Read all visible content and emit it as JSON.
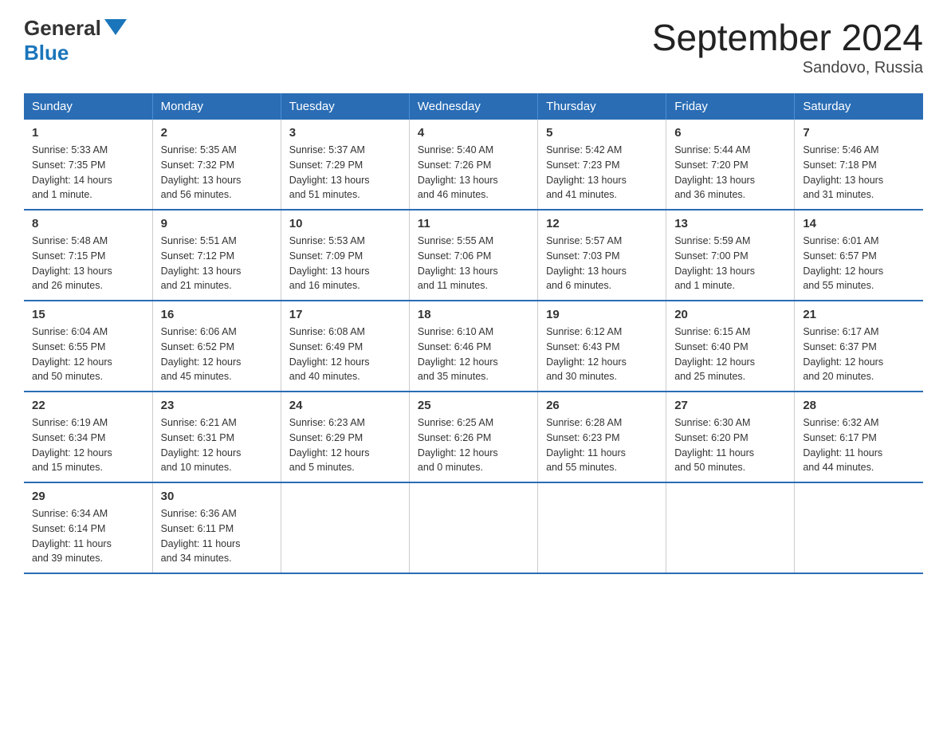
{
  "header": {
    "logo_general": "General",
    "logo_blue": "Blue",
    "title": "September 2024",
    "subtitle": "Sandovo, Russia"
  },
  "weekdays": [
    "Sunday",
    "Monday",
    "Tuesday",
    "Wednesday",
    "Thursday",
    "Friday",
    "Saturday"
  ],
  "weeks": [
    [
      {
        "day": "1",
        "sunrise": "5:33 AM",
        "sunset": "7:35 PM",
        "daylight": "14 hours and 1 minute."
      },
      {
        "day": "2",
        "sunrise": "5:35 AM",
        "sunset": "7:32 PM",
        "daylight": "13 hours and 56 minutes."
      },
      {
        "day": "3",
        "sunrise": "5:37 AM",
        "sunset": "7:29 PM",
        "daylight": "13 hours and 51 minutes."
      },
      {
        "day": "4",
        "sunrise": "5:40 AM",
        "sunset": "7:26 PM",
        "daylight": "13 hours and 46 minutes."
      },
      {
        "day": "5",
        "sunrise": "5:42 AM",
        "sunset": "7:23 PM",
        "daylight": "13 hours and 41 minutes."
      },
      {
        "day": "6",
        "sunrise": "5:44 AM",
        "sunset": "7:20 PM",
        "daylight": "13 hours and 36 minutes."
      },
      {
        "day": "7",
        "sunrise": "5:46 AM",
        "sunset": "7:18 PM",
        "daylight": "13 hours and 31 minutes."
      }
    ],
    [
      {
        "day": "8",
        "sunrise": "5:48 AM",
        "sunset": "7:15 PM",
        "daylight": "13 hours and 26 minutes."
      },
      {
        "day": "9",
        "sunrise": "5:51 AM",
        "sunset": "7:12 PM",
        "daylight": "13 hours and 21 minutes."
      },
      {
        "day": "10",
        "sunrise": "5:53 AM",
        "sunset": "7:09 PM",
        "daylight": "13 hours and 16 minutes."
      },
      {
        "day": "11",
        "sunrise": "5:55 AM",
        "sunset": "7:06 PM",
        "daylight": "13 hours and 11 minutes."
      },
      {
        "day": "12",
        "sunrise": "5:57 AM",
        "sunset": "7:03 PM",
        "daylight": "13 hours and 6 minutes."
      },
      {
        "day": "13",
        "sunrise": "5:59 AM",
        "sunset": "7:00 PM",
        "daylight": "13 hours and 1 minute."
      },
      {
        "day": "14",
        "sunrise": "6:01 AM",
        "sunset": "6:57 PM",
        "daylight": "12 hours and 55 minutes."
      }
    ],
    [
      {
        "day": "15",
        "sunrise": "6:04 AM",
        "sunset": "6:55 PM",
        "daylight": "12 hours and 50 minutes."
      },
      {
        "day": "16",
        "sunrise": "6:06 AM",
        "sunset": "6:52 PM",
        "daylight": "12 hours and 45 minutes."
      },
      {
        "day": "17",
        "sunrise": "6:08 AM",
        "sunset": "6:49 PM",
        "daylight": "12 hours and 40 minutes."
      },
      {
        "day": "18",
        "sunrise": "6:10 AM",
        "sunset": "6:46 PM",
        "daylight": "12 hours and 35 minutes."
      },
      {
        "day": "19",
        "sunrise": "6:12 AM",
        "sunset": "6:43 PM",
        "daylight": "12 hours and 30 minutes."
      },
      {
        "day": "20",
        "sunrise": "6:15 AM",
        "sunset": "6:40 PM",
        "daylight": "12 hours and 25 minutes."
      },
      {
        "day": "21",
        "sunrise": "6:17 AM",
        "sunset": "6:37 PM",
        "daylight": "12 hours and 20 minutes."
      }
    ],
    [
      {
        "day": "22",
        "sunrise": "6:19 AM",
        "sunset": "6:34 PM",
        "daylight": "12 hours and 15 minutes."
      },
      {
        "day": "23",
        "sunrise": "6:21 AM",
        "sunset": "6:31 PM",
        "daylight": "12 hours and 10 minutes."
      },
      {
        "day": "24",
        "sunrise": "6:23 AM",
        "sunset": "6:29 PM",
        "daylight": "12 hours and 5 minutes."
      },
      {
        "day": "25",
        "sunrise": "6:25 AM",
        "sunset": "6:26 PM",
        "daylight": "12 hours and 0 minutes."
      },
      {
        "day": "26",
        "sunrise": "6:28 AM",
        "sunset": "6:23 PM",
        "daylight": "11 hours and 55 minutes."
      },
      {
        "day": "27",
        "sunrise": "6:30 AM",
        "sunset": "6:20 PM",
        "daylight": "11 hours and 50 minutes."
      },
      {
        "day": "28",
        "sunrise": "6:32 AM",
        "sunset": "6:17 PM",
        "daylight": "11 hours and 44 minutes."
      }
    ],
    [
      {
        "day": "29",
        "sunrise": "6:34 AM",
        "sunset": "6:14 PM",
        "daylight": "11 hours and 39 minutes."
      },
      {
        "day": "30",
        "sunrise": "6:36 AM",
        "sunset": "6:11 PM",
        "daylight": "11 hours and 34 minutes."
      },
      null,
      null,
      null,
      null,
      null
    ]
  ],
  "labels": {
    "sunrise": "Sunrise:",
    "sunset": "Sunset:",
    "daylight": "Daylight:"
  }
}
